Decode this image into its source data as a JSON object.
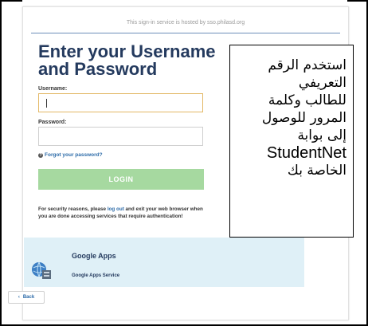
{
  "page": {
    "hosted_notice": "This sign-in service is hosted by sso.philasd.org",
    "title": "Enter your Username and Password"
  },
  "form": {
    "username_label": "Username:",
    "username_value": "",
    "password_label": "Password:",
    "password_value": "",
    "forgot_icon": "?",
    "forgot_link": "Forgot your password?",
    "login_label": "LOGIN"
  },
  "security": {
    "prefix": "For security reasons, please ",
    "link": "log out",
    "suffix": " and exit your web browser when you are done accessing services that require authentication!"
  },
  "apps": {
    "title": "Google Apps",
    "subtitle": "Google Apps Service",
    "icon": "globe-server-icon"
  },
  "back": {
    "icon": "‹",
    "label": "Back"
  },
  "overlay": {
    "line1": "استخدم الرقم",
    "line2": "التعريفي",
    "line3": "للطالب وكلمة",
    "line4": "المرور للوصول",
    "line5": "إلى بوابة",
    "line6": "StudentNet",
    "line7": "الخاصة بك"
  },
  "colors": {
    "title": "#243a5e",
    "link": "#2b6aa8",
    "login_button": "#a6d9a0",
    "apps_bg": "#dff0f7",
    "focus_border": "#e3b866"
  }
}
